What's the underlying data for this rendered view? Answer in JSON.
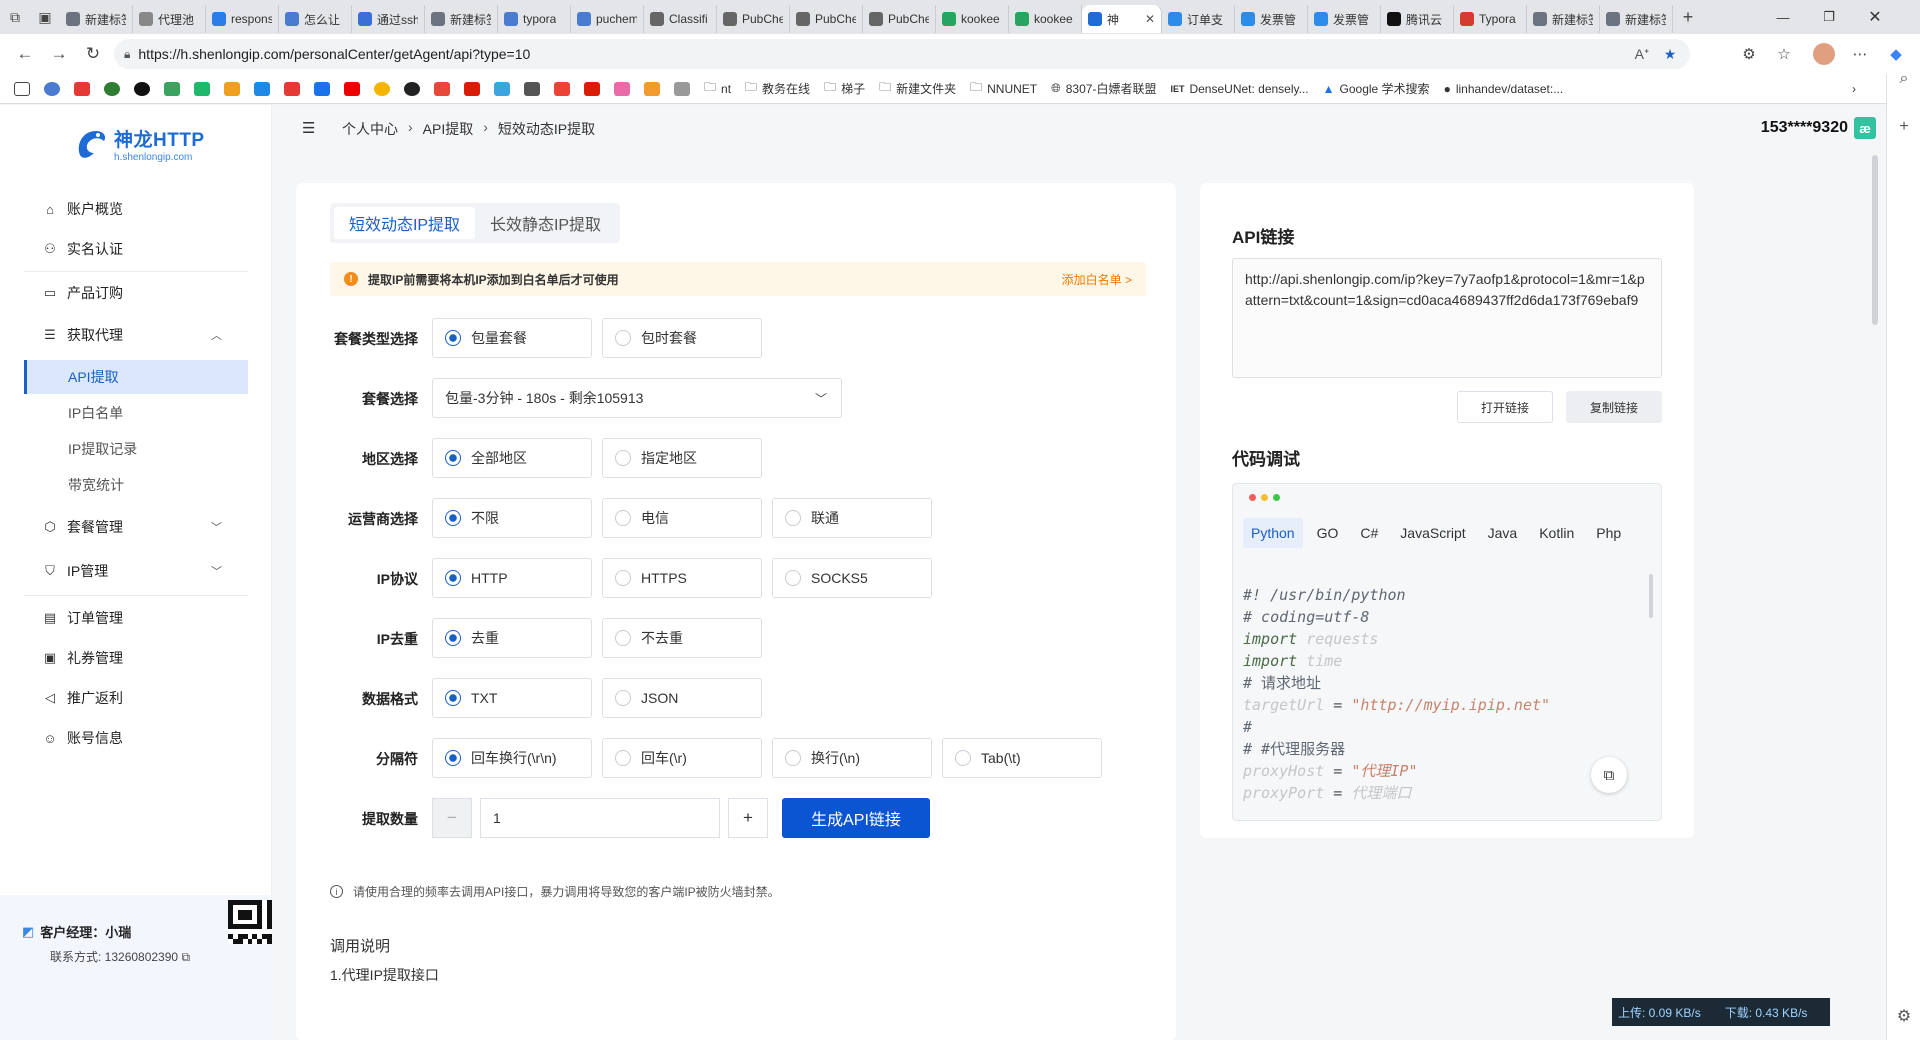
{
  "browser": {
    "tabs": [
      {
        "title": "新建标签页",
        "color": "#6b7280"
      },
      {
        "title": "代理池",
        "color": "#888888"
      },
      {
        "title": "response",
        "color": "#2b7de9"
      },
      {
        "title": "怎么让",
        "color": "#4a7bd0"
      },
      {
        "title": "通过ssh",
        "color": "#3a6fd8"
      },
      {
        "title": "新建标签页",
        "color": "#6b7280"
      },
      {
        "title": "typora",
        "color": "#4a7bd0"
      },
      {
        "title": "puchem",
        "color": "#4a7bd0"
      },
      {
        "title": "Classifi",
        "color": "#666666"
      },
      {
        "title": "PubChe",
        "color": "#666666"
      },
      {
        "title": "PubChe",
        "color": "#666666"
      },
      {
        "title": "PubChe",
        "color": "#666666"
      },
      {
        "title": "kookee",
        "color": "#25a55f"
      },
      {
        "title": "kookee",
        "color": "#25a55f"
      },
      {
        "title": "神",
        "color": "#1e6bd6"
      },
      {
        "title": "订单支",
        "color": "#2b8de9"
      },
      {
        "title": "发票管",
        "color": "#2b8de9"
      },
      {
        "title": "发票管",
        "color": "#2b8de9"
      },
      {
        "title": "腾讯云",
        "color": "#111111"
      },
      {
        "title": "Typora",
        "color": "#d63b2f"
      },
      {
        "title": "新建标签页",
        "color": "#6b7280"
      },
      {
        "title": "新建标签页",
        "color": "#6b7280"
      }
    ],
    "url": "https://h.shenlongip.com/personalCenter/getAgent/api?type=10",
    "bookmarks": [
      "nt",
      "教务在线",
      "梯子",
      "新建文件夹",
      "NNUNET",
      "8307-白嫖者联盟",
      "DenseUNet: densely...",
      "Google 学术搜索",
      "linhandev/dataset:..."
    ]
  },
  "sidebar": {
    "brand": "神龙HTTP",
    "brand_sub": "h.shenlongip.com",
    "items": {
      "overview": "账户概览",
      "realname": "实名认证",
      "products": "产品订购",
      "get_proxy": "获取代理",
      "api": "API提取",
      "whitelist": "IP白名单",
      "records": "IP提取记录",
      "bandwidth": "带宽统计",
      "package": "套餐管理",
      "ipmgr": "IP管理",
      "orders": "订单管理",
      "coupons": "礼券管理",
      "promote": "推广返利",
      "account": "账号信息"
    },
    "manager_label": "客户经理：小瑞",
    "manager_contact": "联系方式: 13260802390"
  },
  "header": {
    "breadcrumb": [
      "个人中心",
      "API提取",
      "短效动态IP提取"
    ],
    "user": "153****9320"
  },
  "form": {
    "tab_active": "短效动态IP提取",
    "tab_other": "长效静态IP提取",
    "notice": "提取IP前需要将本机IP添加到白名单后才可使用",
    "notice_action": "添加白名单 >",
    "pkg_type_label": "套餐类型选择",
    "pkg_type_opts": [
      "包量套餐",
      "包时套餐"
    ],
    "pkg_label": "套餐选择",
    "pkg_value": "包量-3分钟 - 180s - 剩余105913",
    "region_label": "地区选择",
    "region_opts": [
      "全部地区",
      "指定地区"
    ],
    "isp_label": "运营商选择",
    "isp_opts": [
      "不限",
      "电信",
      "联通"
    ],
    "proto_label": "IP协议",
    "proto_opts": [
      "HTTP",
      "HTTPS",
      "SOCKS5"
    ],
    "dedup_label": "IP去重",
    "dedup_opts": [
      "去重",
      "不去重"
    ],
    "format_label": "数据格式",
    "format_opts": [
      "TXT",
      "JSON"
    ],
    "sep_label": "分隔符",
    "sep_opts": [
      "回车换行(\\r\\n)",
      "回车(\\r)",
      "换行(\\n)",
      "Tab(\\t)"
    ],
    "count_label": "提取数量",
    "count_value": "1",
    "generate": "生成API链接",
    "tip": "请使用合理的频率去调用API接口，暴力调用将导致您的客户端IP被防火墙封禁。",
    "doc_title": "调用说明",
    "doc_item": "1.代理IP提取接口"
  },
  "api": {
    "title": "API链接",
    "link": "http://api.shenlongip.com/ip?key=7y7aofp1&protocol=1&mr=1&pattern=txt&count=1&sign=cd0aca4689437ff2d6da173f769ebaf9",
    "open": "打开链接",
    "copy": "复制链接",
    "debug_title": "代码调试",
    "langs": [
      "Python",
      "GO",
      "C#",
      "JavaScript",
      "Java",
      "Kotlin",
      "Php"
    ],
    "code": {
      "l1": "#! /usr/bin/python",
      "l2": "# coding=utf-8",
      "l3a": "import",
      "l3b": " requests",
      "l4a": "import",
      "l4b": " time",
      "l5": "# 请求地址",
      "l6a": "targetUrl",
      "l6b": " = ",
      "l6c": "\"http://myip.ipip.net\"",
      "l7": "#",
      "l8": "# #代理服务器",
      "l9a": "proxyHost",
      "l9b": " = ",
      "l9c": "\"代理IP\"",
      "l10a": "proxyPort",
      "l10b": " = ",
      "l10c": "代理端口"
    }
  },
  "netspeed": {
    "up": "上传: 0.09 KB/s",
    "down": "下载: 0.43 KB/s"
  }
}
